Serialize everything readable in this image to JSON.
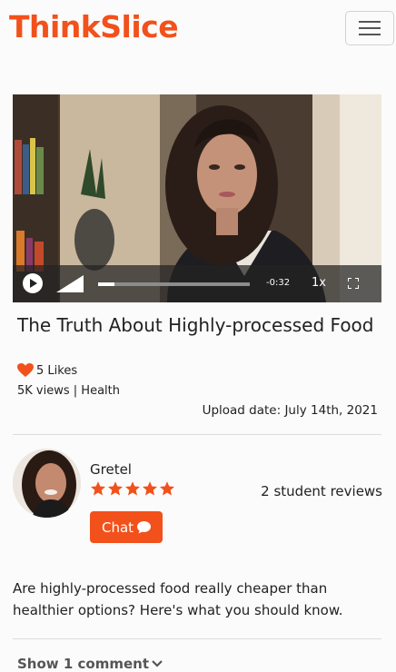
{
  "brand": {
    "name": "ThinkSlice",
    "color": "#f2511b"
  },
  "nav": {
    "menu_icon": "hamburger-menu-icon"
  },
  "video": {
    "time_remaining": "-0:32",
    "speed": "1x",
    "progress": 0.11,
    "volume_level": 1.0,
    "icons": [
      "play-icon",
      "volume-icon",
      "fullscreen-icon"
    ]
  },
  "content": {
    "title": "The Truth About Highly-processed Food",
    "likes": "5 Likes",
    "views": "5K views",
    "category": "Health",
    "upload_date": "Upload date: July 14th, 2021",
    "description": "Are highly-processed food really cheaper than healthier options? Here's what you should know."
  },
  "instructor": {
    "name": "Gretel",
    "rating": 5,
    "rating_max": 5,
    "reviews": "2 student reviews",
    "chat_label": "Chat"
  },
  "comments": {
    "toggle_label": "Show 1 comment"
  },
  "colors": {
    "accent": "#f2511b",
    "text": "#222222",
    "divider": "#dcdcdc"
  }
}
